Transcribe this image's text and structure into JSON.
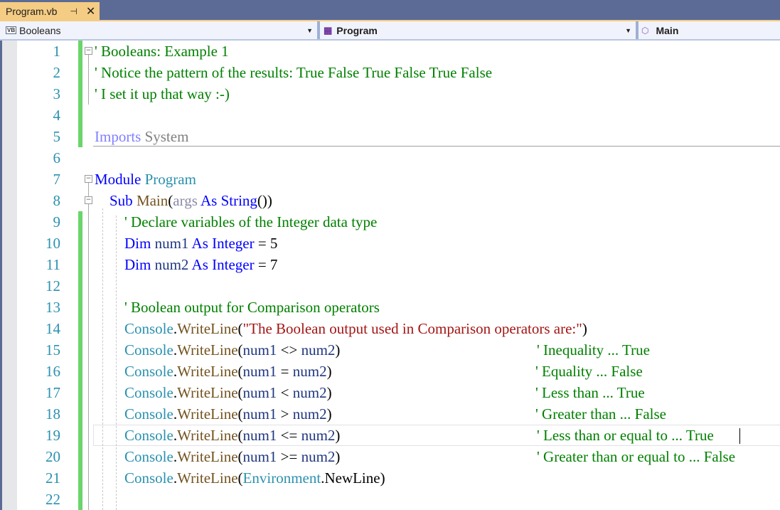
{
  "tab": {
    "title": "Program.vb",
    "pin_icon": "pin-icon",
    "close_icon": "close-icon"
  },
  "nav": {
    "project": "Booleans",
    "project_badge": "VB",
    "type": "Program",
    "member": "Main"
  },
  "colors": {
    "keyword": "#0000ff",
    "type": "#2b91af",
    "method": "#74531f",
    "variable": "#1f377f",
    "comment": "#008000",
    "string": "#a31515"
  },
  "editor": {
    "current_line": 19,
    "lines": [
      {
        "n": "1",
        "tokens": [
          [
            "' Booleans: Example 1",
            "c"
          ]
        ]
      },
      {
        "n": "2",
        "tokens": [
          [
            "' Notice the pattern of the results: True False True False True False",
            "c"
          ]
        ]
      },
      {
        "n": "3",
        "tokens": [
          [
            "' I set it up that way :-)",
            "c"
          ]
        ]
      },
      {
        "n": "4",
        "tokens": []
      },
      {
        "n": "5",
        "tokens": [
          [
            "Imports",
            "imp"
          ],
          [
            " System",
            "sys"
          ]
        ]
      },
      {
        "n": "6",
        "tokens": []
      },
      {
        "n": "7",
        "tokens": [
          [
            "Module",
            "k"
          ],
          [
            " ",
            "p"
          ],
          [
            "Program",
            "ty"
          ]
        ]
      },
      {
        "n": "8",
        "tokens": [
          [
            "    ",
            "p"
          ],
          [
            "Sub",
            "k"
          ],
          [
            " ",
            "p"
          ],
          [
            "Main",
            "m"
          ],
          [
            "(",
            "p"
          ],
          [
            "args",
            "dim"
          ],
          [
            " ",
            "p"
          ],
          [
            "As",
            "k"
          ],
          [
            " ",
            "p"
          ],
          [
            "String",
            "k"
          ],
          [
            "())",
            "p"
          ]
        ]
      },
      {
        "n": "9",
        "tokens": [
          [
            "        ",
            "p"
          ],
          [
            "' Declare variables of the Integer data type",
            "c"
          ]
        ]
      },
      {
        "n": "10",
        "tokens": [
          [
            "        ",
            "p"
          ],
          [
            "Dim",
            "k"
          ],
          [
            " num1 ",
            "v"
          ],
          [
            "As",
            "k"
          ],
          [
            " ",
            "p"
          ],
          [
            "Integer",
            "k"
          ],
          [
            " = 5",
            "p"
          ]
        ]
      },
      {
        "n": "11",
        "tokens": [
          [
            "        ",
            "p"
          ],
          [
            "Dim",
            "k"
          ],
          [
            " num2 ",
            "v"
          ],
          [
            "As",
            "k"
          ],
          [
            " ",
            "p"
          ],
          [
            "Integer",
            "k"
          ],
          [
            " = 7",
            "p"
          ]
        ]
      },
      {
        "n": "12",
        "tokens": []
      },
      {
        "n": "13",
        "tokens": [
          [
            "        ",
            "p"
          ],
          [
            "' Boolean output for Comparison operators",
            "c"
          ]
        ]
      },
      {
        "n": "14",
        "tokens": [
          [
            "        ",
            "p"
          ],
          [
            "Console",
            "ty"
          ],
          [
            ".",
            "p"
          ],
          [
            "WriteLine",
            "m"
          ],
          [
            "(",
            "p"
          ],
          [
            "\"The Boolean output used in Comparison operators are:\"",
            "s"
          ],
          [
            ")",
            "p"
          ]
        ]
      },
      {
        "n": "15",
        "tokens": [
          [
            "        ",
            "p"
          ],
          [
            "Console",
            "ty"
          ],
          [
            ".",
            "p"
          ],
          [
            "WriteLine",
            "m"
          ],
          [
            "(",
            "p"
          ],
          [
            "num1",
            "v"
          ],
          [
            " <> ",
            "p"
          ],
          [
            "num2",
            "v"
          ],
          [
            ")",
            "p"
          ]
        ],
        "comment": "' Inequality ... True"
      },
      {
        "n": "16",
        "tokens": [
          [
            "        ",
            "p"
          ],
          [
            "Console",
            "ty"
          ],
          [
            ".",
            "p"
          ],
          [
            "WriteLine",
            "m"
          ],
          [
            "(",
            "p"
          ],
          [
            "num1",
            "v"
          ],
          [
            " = ",
            "p"
          ],
          [
            "num2",
            "v"
          ],
          [
            ")",
            "p"
          ]
        ],
        "comment": "' Equality ... False"
      },
      {
        "n": "17",
        "tokens": [
          [
            "        ",
            "p"
          ],
          [
            "Console",
            "ty"
          ],
          [
            ".",
            "p"
          ],
          [
            "WriteLine",
            "m"
          ],
          [
            "(",
            "p"
          ],
          [
            "num1",
            "v"
          ],
          [
            " < ",
            "p"
          ],
          [
            "num2",
            "v"
          ],
          [
            ")",
            "p"
          ]
        ],
        "comment": "' Less than ... True"
      },
      {
        "n": "18",
        "tokens": [
          [
            "        ",
            "p"
          ],
          [
            "Console",
            "ty"
          ],
          [
            ".",
            "p"
          ],
          [
            "WriteLine",
            "m"
          ],
          [
            "(",
            "p"
          ],
          [
            "num1",
            "v"
          ],
          [
            " > ",
            "p"
          ],
          [
            "num2",
            "v"
          ],
          [
            ")",
            "p"
          ]
        ],
        "comment": "' Greater than ... False"
      },
      {
        "n": "19",
        "tokens": [
          [
            "        ",
            "p"
          ],
          [
            "Console",
            "ty"
          ],
          [
            ".",
            "p"
          ],
          [
            "WriteLine",
            "m"
          ],
          [
            "(",
            "p"
          ],
          [
            "num1",
            "v"
          ],
          [
            " <= ",
            "p"
          ],
          [
            "num2",
            "v"
          ],
          [
            ")",
            "p"
          ]
        ],
        "comment": "' Less than or equal to ... True"
      },
      {
        "n": "20",
        "tokens": [
          [
            "        ",
            "p"
          ],
          [
            "Console",
            "ty"
          ],
          [
            ".",
            "p"
          ],
          [
            "WriteLine",
            "m"
          ],
          [
            "(",
            "p"
          ],
          [
            "num1",
            "v"
          ],
          [
            " >= ",
            "p"
          ],
          [
            "num2",
            "v"
          ],
          [
            ")",
            "p"
          ]
        ],
        "comment": "' Greater than or equal to ... False"
      },
      {
        "n": "21",
        "tokens": [
          [
            "        ",
            "p"
          ],
          [
            "Console",
            "ty"
          ],
          [
            ".",
            "p"
          ],
          [
            "WriteLine",
            "m"
          ],
          [
            "(",
            "p"
          ],
          [
            "Environment",
            "ty"
          ],
          [
            ".",
            "p"
          ],
          [
            "NewLine",
            "p"
          ],
          [
            ")",
            "p"
          ]
        ]
      },
      {
        "n": "22",
        "tokens": []
      }
    ]
  }
}
